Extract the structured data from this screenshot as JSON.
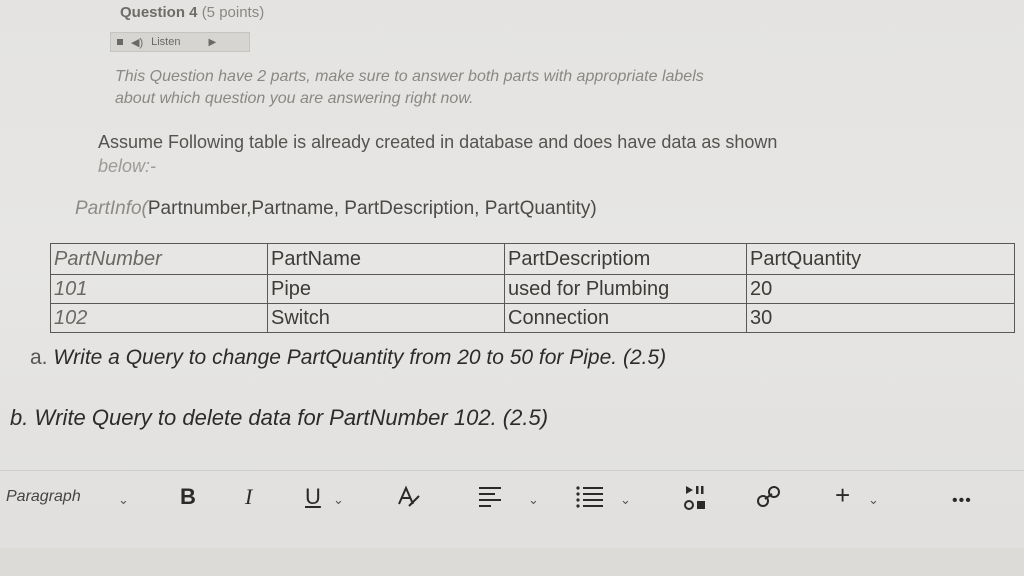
{
  "question": {
    "title": "Question 4",
    "points": "(5 points)",
    "listen_label": "Listen"
  },
  "intro_lines": [
    "This Question have 2 parts, make sure to answer both parts with appropriate labels",
    "about which question you are answering right now."
  ],
  "assume_lines": [
    "Assume Following table is already created in database and does have data as shown",
    "below:-"
  ],
  "schema_prefix": "PartInfo(",
  "schema_rest": "Partnumber,Partname, PartDescription, PartQuantity)",
  "table": {
    "headers": [
      "PartNumber",
      "PartName",
      "PartDescriptiom",
      "PartQuantity"
    ],
    "rows": [
      [
        "101",
        "Pipe",
        "used for Plumbing",
        "20"
      ],
      [
        "102",
        "Switch",
        "Connection",
        "30"
      ]
    ]
  },
  "parts": {
    "a_label": "a.",
    "a_text": "Write a Query to change PartQuantity from 20 to 50 for Pipe. (2.5)",
    "b_text": "b. Write Query to delete data for PartNumber 102. (2.5)"
  },
  "editor_toolbar": {
    "paragraph_label": "Paragraph",
    "bold": "B",
    "italic": "I",
    "underline": "U",
    "plus": "+",
    "more": "•••"
  }
}
